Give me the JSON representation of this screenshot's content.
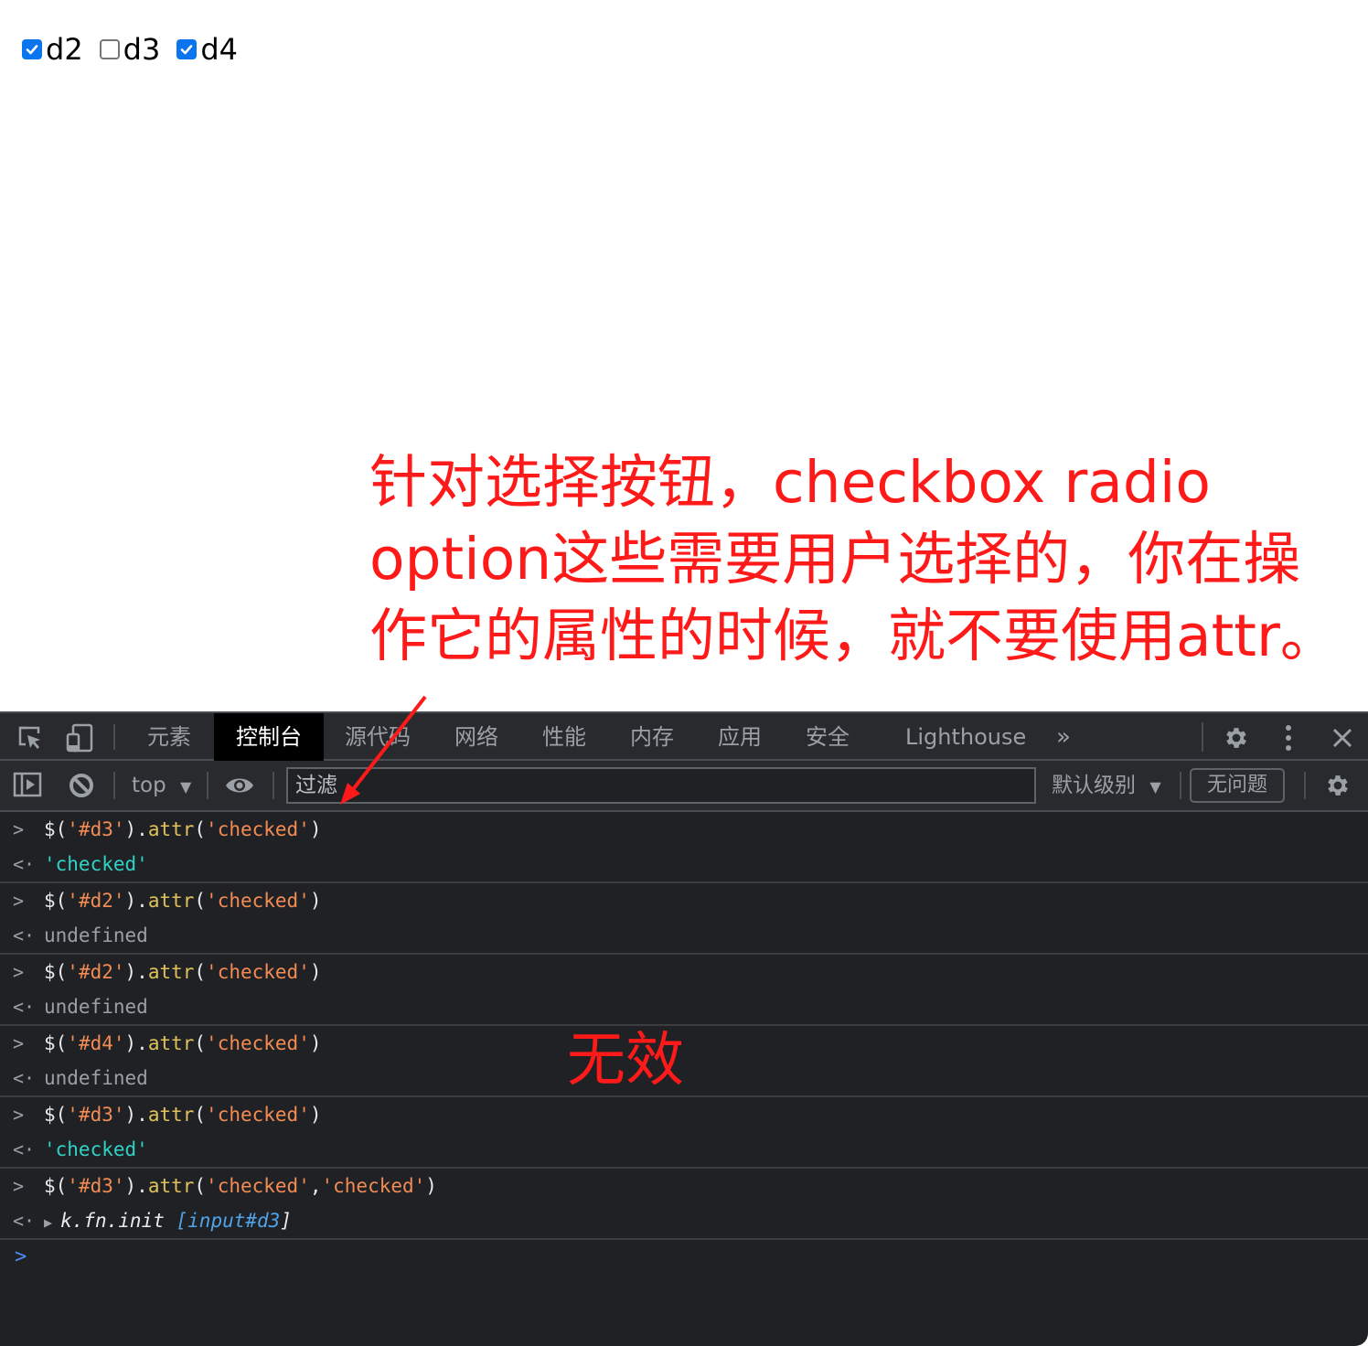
{
  "page": {
    "checkboxes": [
      {
        "id": "d2",
        "label": "d2",
        "checked": true
      },
      {
        "id": "d3",
        "label": "d3",
        "checked": false
      },
      {
        "id": "d4",
        "label": "d4",
        "checked": true
      }
    ],
    "annotation_lines": [
      "针对选择按钮，checkbox radio",
      "option这些需要用户选择的，你在操",
      "作它的属性的时候，就不要使用attr。"
    ],
    "annotation_color": "#ff1a1a"
  },
  "devtools": {
    "icons": {
      "inspect": "inspect-element-icon",
      "device": "device-toolbar-icon",
      "more_tabs": "double-chevron-right-icon",
      "settings": "gear-icon",
      "menu": "vertical-dots-icon",
      "close": "close-icon"
    },
    "tabs": [
      {
        "label": "元素",
        "active": false
      },
      {
        "label": "控制台",
        "active": true
      },
      {
        "label": "源代码",
        "active": false
      },
      {
        "label": "网络",
        "active": false
      },
      {
        "label": "性能",
        "active": false
      },
      {
        "label": "内存",
        "active": false
      },
      {
        "label": "应用",
        "active": false
      },
      {
        "label": "安全",
        "active": false
      },
      {
        "label": "Lighthouse",
        "active": false
      }
    ],
    "more_tabs_label": "»",
    "toolbar": {
      "context_label": "top",
      "filter_placeholder": "过滤",
      "level_label": "默认级别",
      "issues_label": "无问题"
    },
    "console": {
      "entries": [
        {
          "input": {
            "prefix": "$(",
            "arg": "'#d3'",
            "mid": ").",
            "method": "attr",
            "open": "(",
            "args": [
              "'checked'"
            ],
            "close": ")"
          },
          "output": {
            "type": "string",
            "text": "'checked'"
          }
        },
        {
          "input": {
            "prefix": "$(",
            "arg": "'#d2'",
            "mid": ").",
            "method": "attr",
            "open": "(",
            "args": [
              "'checked'"
            ],
            "close": ")"
          },
          "output": {
            "type": "undefined",
            "text": "undefined"
          }
        },
        {
          "input": {
            "prefix": "$(",
            "arg": "'#d2'",
            "mid": ").",
            "method": "attr",
            "open": "(",
            "args": [
              "'checked'"
            ],
            "close": ")"
          },
          "output": {
            "type": "undefined",
            "text": "undefined"
          }
        },
        {
          "input": {
            "prefix": "$(",
            "arg": "'#d4'",
            "mid": ").",
            "method": "attr",
            "open": "(",
            "args": [
              "'checked'"
            ],
            "close": ")"
          },
          "output": {
            "type": "undefined",
            "text": "undefined"
          }
        },
        {
          "input": {
            "prefix": "$(",
            "arg": "'#d3'",
            "mid": ").",
            "method": "attr",
            "open": "(",
            "args": [
              "'checked'"
            ],
            "close": ")"
          },
          "output": {
            "type": "string",
            "text": "'checked'"
          }
        },
        {
          "input": {
            "prefix": "$(",
            "arg": "'#d3'",
            "mid": ").",
            "method": "attr",
            "open": "(",
            "args": [
              "'checked'",
              "'checked'"
            ],
            "close": ")"
          },
          "output": {
            "type": "object",
            "name": "k.fn.init",
            "detail": "input#d3"
          }
        }
      ],
      "input_gutter": ">",
      "output_gutter": "<·",
      "prompt_gutter": ">"
    },
    "invalid_note": "无效"
  }
}
